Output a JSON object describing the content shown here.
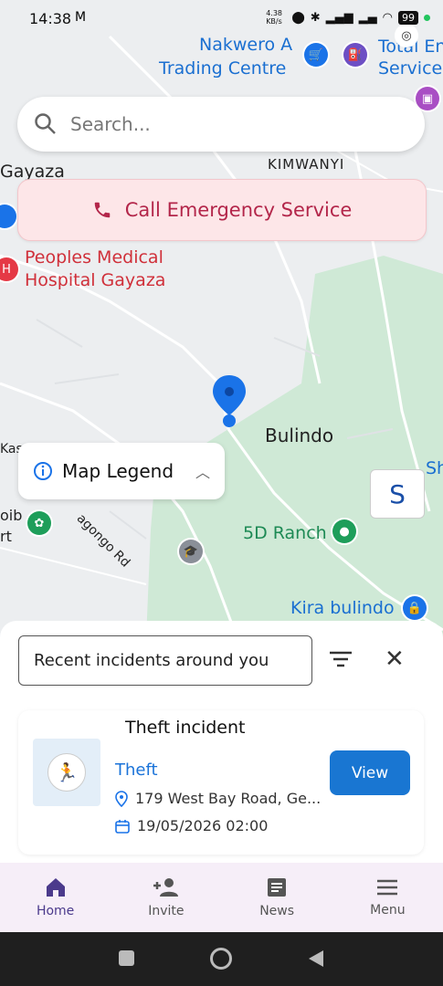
{
  "status_bar": {
    "time": "14:38",
    "speed": "4.38 KB/s",
    "battery": "99"
  },
  "map_labels": {
    "nakwero": "Nakwero A",
    "trading_centre": "Trading Centre",
    "total": "Total En",
    "service": "Service",
    "gayaza": "Gayaza",
    "kimwanyi": "KIMWANYI",
    "hospital_line1": "Peoples Medical",
    "hospital_line2": "Hospital Gayaza",
    "bulindo": "Bulindo",
    "ranch": "5D Ranch",
    "kira_bulindo": "Kira bulindo",
    "road": "agongo Rd",
    "kas": "Kas",
    "oib": "oib",
    "rt": "rt",
    "sh": "Sh"
  },
  "search": {
    "placeholder": "Search..."
  },
  "emergency": {
    "label": "Call Emergency Service"
  },
  "legend": {
    "label": "Map Legend"
  },
  "incidents": {
    "header": "Recent incidents around you",
    "card_title": "Theft incident",
    "type": "Theft",
    "address": "179 West Bay Road, Ge...",
    "datetime": "19/05/2026 02:00",
    "view_label": "View"
  },
  "nav": {
    "home": "Home",
    "invite": "Invite",
    "news": "News",
    "menu": "Menu"
  }
}
